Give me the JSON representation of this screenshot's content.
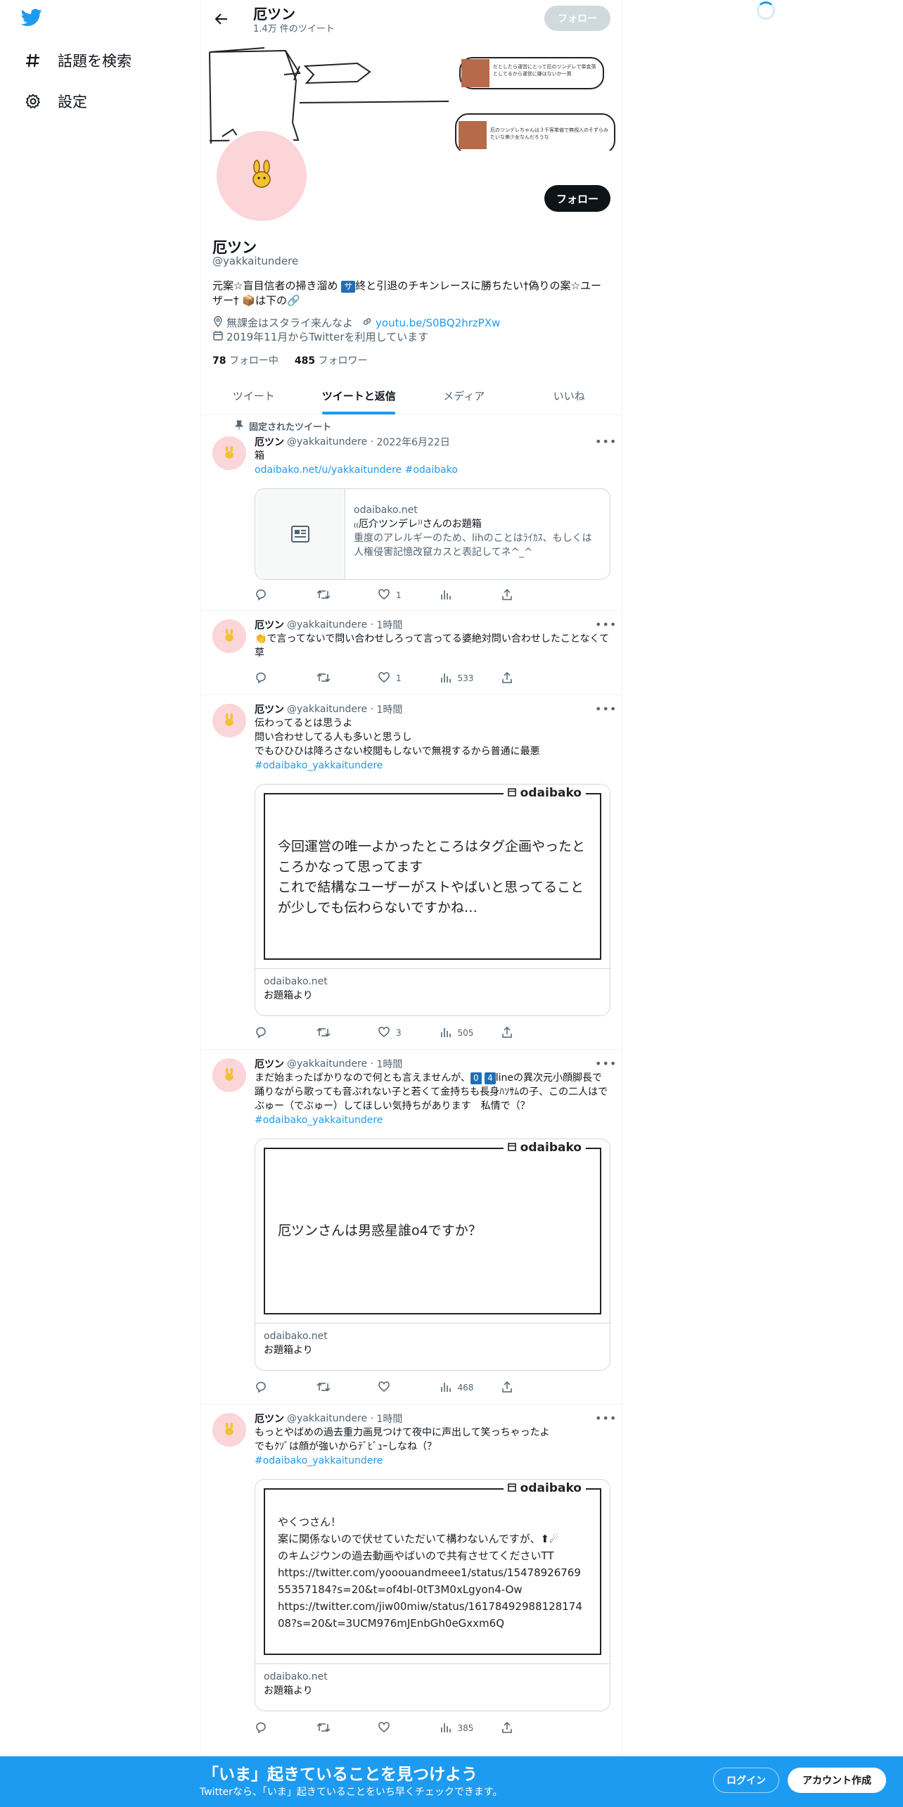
{
  "nav": {
    "explore_label": "話題を検索",
    "settings_label": "設定"
  },
  "header": {
    "name": "厄ツン",
    "tweet_count": "1.4万 件のツイート",
    "follow_label": "フォロー"
  },
  "banner": {
    "box1_text": "だとしたら運営にとって厄のツンデレで単金落としてるから運営に嫌はないか一質",
    "box2_text": "厄のツンデレちゃんは３千客単値で無視入のそずらみたいな美少女なんだろうな"
  },
  "profile": {
    "follow_label": "フォロー",
    "name": "厄ツン",
    "handle": "@yakkaitundere",
    "bio_part1": "元案☆盲目信者の掃き溜め ",
    "bio_box": "サ",
    "bio_part2": "終と引退のチキンレースに勝ちたい†偽りの案☆ユーザー† 📦は下の🔗",
    "location": "無課金はスタライ来んなよ",
    "link": "youtu.be/S0BQ2hrzPXw",
    "joined": "2019年11月からTwitterを利用しています",
    "following_count": "78",
    "following_label": "フォロー中",
    "followers_count": "485",
    "followers_label": "フォロワー"
  },
  "tabs": [
    "ツイート",
    "ツイートと返信",
    "メディア",
    "いいね"
  ],
  "tweets": [
    {
      "pinned_label": "固定されたツイート",
      "name": "厄ツン",
      "handle": "@yakkaitundere",
      "time": "2022年6月22日",
      "text": "箱",
      "links": "odaibako.net/u/yakkaitundere #odaibako",
      "card": {
        "domain": "odaibako.net",
        "title": "₍₍厄介ツンデレ⁾⁾さんのお題箱",
        "desc": "重度のアレルギーのため、lihのことはﾗｲｶｽ、もしくは人権侵害記憶改竄カスと表記してネ^_^"
      },
      "likes": "1",
      "views": ""
    },
    {
      "name": "厄ツン",
      "handle": "@yakkaitundere",
      "time": "1時間",
      "text": "👏で言ってないで問い合わせしろって言ってる婆絶対問い合わせしたことなくて草",
      "likes": "1",
      "views": "533"
    },
    {
      "name": "厄ツン",
      "handle": "@yakkaitundere",
      "time": "1時間",
      "text": "伝わってるとは思うよ\n問い合わせしてる人も多いと思うし\nでもひひひは降ろさない校閲もしないで無視するから普通に最悪",
      "hashtag": "#odaibako_yakkaitundere",
      "card": {
        "brand": "odaibako",
        "question": "今回運営の唯一よかったところはタグ企画やったところかなって思ってます\nこれで結構なユーザーがストやばいと思ってることが少しでも伝わらないですかね…",
        "domain": "odaibako.net",
        "title": "お題箱より"
      },
      "likes": "3",
      "views": "505"
    },
    {
      "name": "厄ツン",
      "handle": "@yakkaitundere",
      "time": "1時間",
      "text_part1": "まだ始まったばかりなので何とも言えませんが、",
      "text_box1": "0",
      "text_box2": "4",
      "text_part2": "lineの異次元小顔脚長で踊りながら歌っても音ぶれない子と若くて金持ちも長身ﾊｿｻﾑの子、この二人はでぶゅー（でぶゅー）してほしい気持ちがあります　私情で（？",
      "hashtag": "#odaibako_yakkaitundere",
      "card": {
        "brand": "odaibako",
        "question": "厄ツンさんは男惑星誰o4ですか？",
        "domain": "odaibako.net",
        "title": "お題箱より"
      },
      "likes": "",
      "views": "468"
    },
    {
      "name": "厄ツン",
      "handle": "@yakkaitundere",
      "time": "1時間",
      "text": "もっとやばめの過去重力画見つけて夜中に声出して笑っちゃったよ\nでもｸｿﾞは顔が強いからﾃﾞﾋﾞｭｰしなね（？",
      "hashtag": "#odaibako_yakkaitundere",
      "card": {
        "brand": "odaibako",
        "question": "やくつさん！\n案に関係ないので伏せていただいて構わないんですが、⬆☄\nのキムジウンの過去動画やばいので共有させてくださいTT\nhttps://twitter.com/yooouandmeee1/status/1547892676955357184?s=20&t=of4bI-0tT3M0xLgyon4-Ow\nhttps://twitter.com/jiw00miw/status/1617849298812817408?s=20&t=3UCM976mJEnbGh0eGxxm6Q",
        "domain": "odaibako.net",
        "title": "お題箱より"
      },
      "likes": "",
      "views": "385"
    }
  ],
  "bottom_bar": {
    "title": "「いま」起きていることを見つけよう",
    "subtitle": "Twitterなら、「いま」起きていることをいち早くチェックできます。",
    "login_label": "ログイン",
    "signup_label": "アカウント作成"
  },
  "colors": {
    "accent": "#1d9bf0",
    "text": "#0f1419",
    "muted": "#536471",
    "avatar_bg": "#fbd5d8",
    "follow_dark": "#0f1419"
  },
  "icons": [
    "twitter-logo-icon",
    "hashtag-icon",
    "gear-icon",
    "back-arrow-icon",
    "location-icon",
    "link-icon",
    "calendar-icon",
    "pin-icon",
    "reply-icon",
    "retweet-icon",
    "like-icon",
    "views-icon",
    "share-icon",
    "article-icon",
    "more-icon",
    "loading-spinner"
  ]
}
